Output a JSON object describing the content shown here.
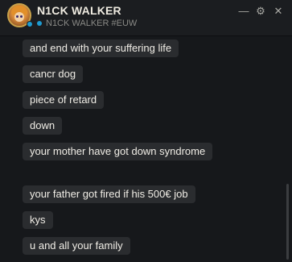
{
  "header": {
    "name": "N1CK WALKER",
    "riot_id": "N1CK WALKER #EUW",
    "avatar_icon": "champion-avatar-icon",
    "status_color": "#1e9bd1"
  },
  "controls": {
    "minimize_icon": "minimize-icon",
    "settings_icon": "gear-icon",
    "close_icon": "close-icon",
    "minimize_glyph": "—",
    "settings_glyph": "⚙",
    "close_glyph": "✕"
  },
  "messages": [
    "and end with your suffering life",
    "cancr dog",
    "piece of retard",
    "down",
    "your mother have got down syndrome",
    "your father got fired if his 500€ job",
    "kys",
    "u and all your family"
  ],
  "colors": {
    "background": "#16181b",
    "bubble": "#2a2c2f",
    "text": "#f0ede6",
    "muted": "#8a8a86"
  }
}
